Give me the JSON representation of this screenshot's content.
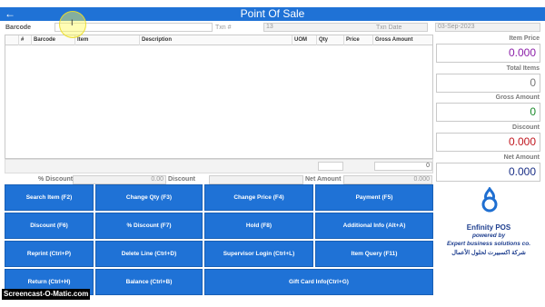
{
  "window": {
    "title": "Point Of Sale"
  },
  "header": {
    "barcode_label": "Barcode",
    "barcode_value": "",
    "txn_label": "Txn #",
    "txn_value": "13",
    "txn_date_label": "Txn Date",
    "txn_date_value": "03-Sep-2023"
  },
  "grid": {
    "columns": [
      "#",
      "Barcode",
      "Item",
      "Description",
      "UOM",
      "Qty",
      "Price",
      "Gross Amount"
    ],
    "total_value": "0"
  },
  "discounts": {
    "pct_discount_label": "% Discount",
    "pct_discount_value": "0.00",
    "discount_label": "Discount",
    "discount_value": "",
    "net_amount_label": "Net Amount",
    "net_amount_value": "0.000"
  },
  "summary": {
    "item_price_label": "Item Price",
    "item_price_value": "0.000",
    "item_price_color": "#8b1fa8",
    "total_items_label": "Total Items",
    "total_items_value": "0",
    "gross_amount_label": "Gross Amount",
    "gross_amount_value": "0",
    "gross_amount_color": "#1a8a2a",
    "discount_label": "Discount",
    "discount_value": "0.000",
    "discount_color": "#c0171f",
    "net_amount_label": "Net Amount",
    "net_amount_value": "0.000",
    "net_amount_color": "#1a2f86"
  },
  "buttons": {
    "search_item": "Search Item (F2)",
    "change_qty": "Change Qty (F3)",
    "change_price": "Change Price (F4)",
    "payment": "Payment (F5)",
    "discount": "Discount (F6)",
    "pct_discount": "% Discount (F7)",
    "hold": "Hold (F8)",
    "additional_info": "Additional Info (Alt+A)",
    "reprint": "Reprint (Ctrl+P)",
    "delete_line": "Delete Line (Ctrl+D)",
    "supervisor_login": "Supervisor Login (Ctrl+L)",
    "item_query": "Item Query (F11)",
    "return": "Return (Ctrl+H)",
    "balance": "Balance (Ctrl+B)",
    "gift_card_info": "Gift Card Info(Ctrl+G)"
  },
  "brand": {
    "name": "Enfinity POS",
    "powered_by": "powered by",
    "company": "Expert business solutions co.",
    "company_arabic": "شركة اكسبيرت لحلول الأعمال",
    "color": "#1f3f8f"
  },
  "watermark": "Screencast-O-Matic.com"
}
